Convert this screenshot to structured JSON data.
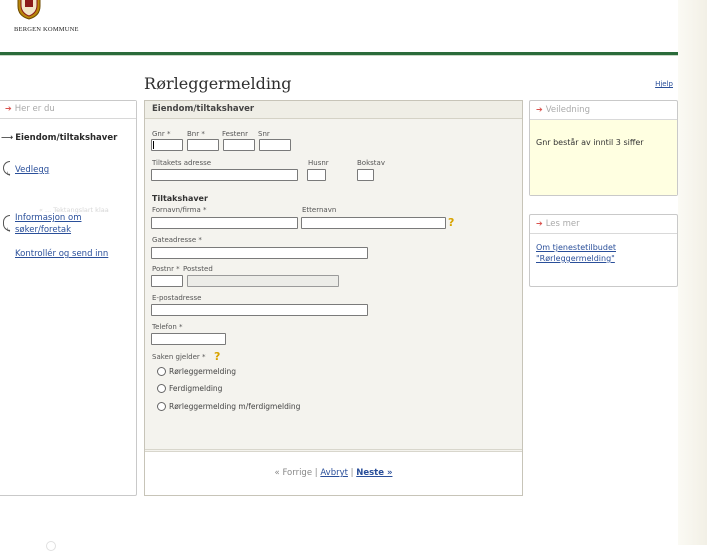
{
  "header": {
    "org_name": "BERGEN KOMMUNE",
    "logo_icon": "city-crest-icon",
    "accent_color": "#2a6b3a"
  },
  "page": {
    "title": "Rørleggermelding",
    "help_label": "Hjelp"
  },
  "sidebar": {
    "heading": "Her er du",
    "current_step": "Eiendom/tiltakshaver",
    "steps": [
      {
        "label": "Vedlegg"
      },
      {
        "label_line1": "Informasjon om",
        "label_line2": "søker/foretak"
      },
      {
        "label": "Kontrollér og send inn"
      }
    ],
    "ghost_text": "« ... Tektangslart klaa"
  },
  "form": {
    "heading": "Eiendom/tiltakshaver",
    "property": {
      "gnr_label": "Gnr *",
      "bnr_label": "Bnr *",
      "festenr_label": "Festenr",
      "snr_label": "Snr",
      "address_label": "Tiltakets adresse",
      "husnr_label": "Husnr",
      "bokstav_label": "Bokstav"
    },
    "owner": {
      "section_title": "Tiltakshaver",
      "firstname_label": "Fornavn/firma *",
      "lastname_label": "Etternavn",
      "street_label": "Gateadresse *",
      "postnr_label": "Postnr *",
      "poststed_label": "Poststed",
      "email_label": "E-postadresse",
      "phone_label": "Telefon *"
    },
    "case": {
      "label": "Saken gjelder *",
      "options": [
        "Rørleggermelding",
        "Ferdigmelding",
        "Rørleggermelding m/ferdigmelding"
      ]
    },
    "nav": {
      "prev": "« Forrige",
      "sep": "|",
      "cancel": "Avbryt",
      "next": "Neste »"
    }
  },
  "guide": {
    "heading": "Veiledning",
    "text": "Gnr består av inntil 3 siffer"
  },
  "read_more": {
    "heading": "Les mer",
    "link_line1": "Om tjenestetilbudet",
    "link_line2": "\"Rørleggermelding\""
  }
}
